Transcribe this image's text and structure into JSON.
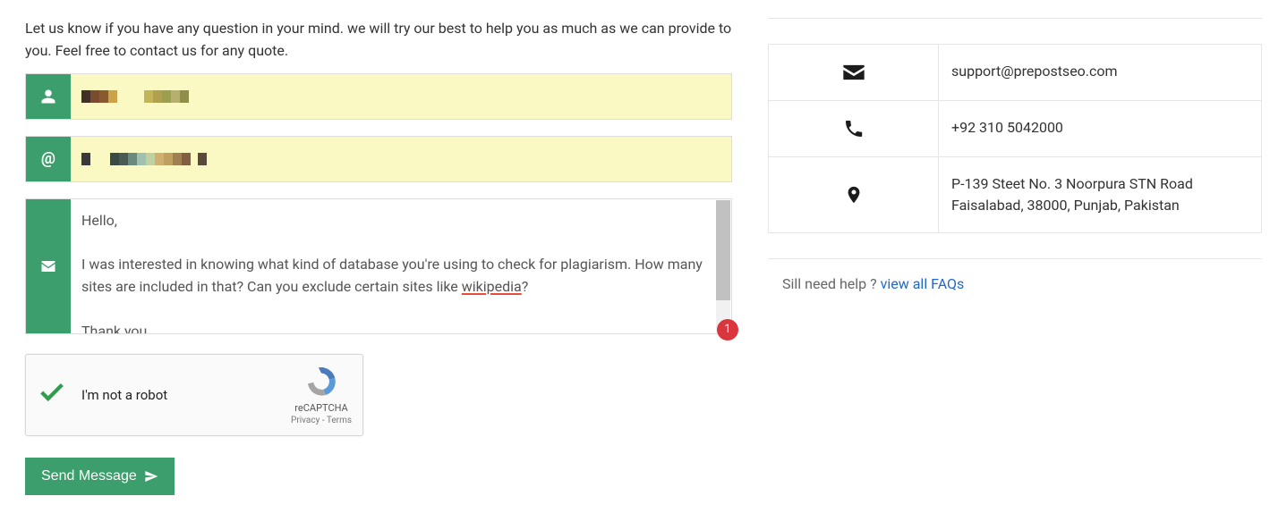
{
  "intro": "Let us know if you have any question in your mind. we will try our best to help you as much as we can provide to you. Feel free to contact us for any quote.",
  "form": {
    "name_value": "",
    "email_value": "",
    "message_value": "Hello,\n\nI was interested in knowing what kind of database you're using to check for plagiarism. How many sites are included in that? Can you exclude certain sites like wikipedia?\n\nThank you",
    "badge_count": "1"
  },
  "recaptcha": {
    "label": "I'm not a robot",
    "brand": "reCAPTCHA",
    "privacy": "Privacy",
    "terms": "Terms"
  },
  "send_label": "Send Message",
  "contact": {
    "email": "support@prepostseo.com",
    "phone": "+92 310 5042000",
    "address": "P-139 Steet No. 3 Noorpura STN Road Faisalabad, 38000, Punjab, Pakistan"
  },
  "faq": {
    "prefix": "Sill need help ? ",
    "link_text": "view all FAQs"
  }
}
